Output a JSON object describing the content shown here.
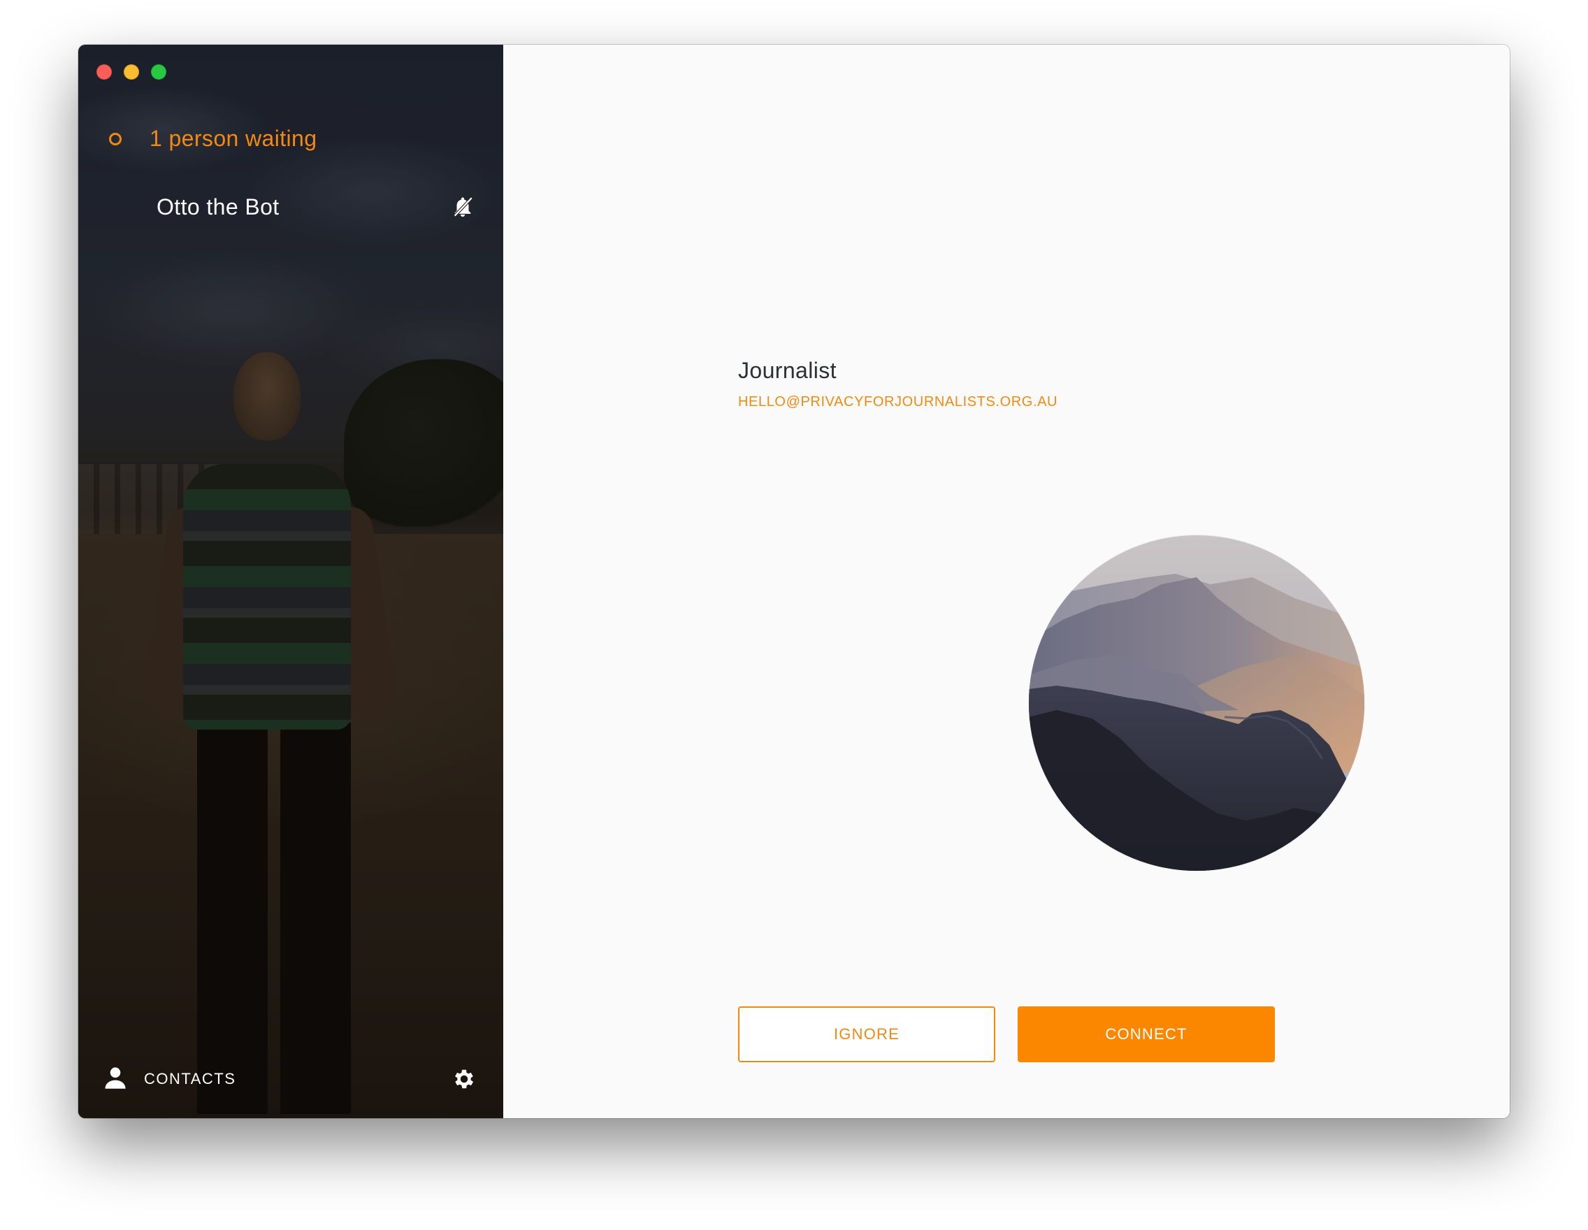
{
  "window": {
    "controls": [
      "close",
      "minimize",
      "maximize"
    ]
  },
  "sidebar": {
    "status_text": "1 person waiting",
    "contact": {
      "name": "Otto the Bot",
      "notification_icon": "bell-off-icon"
    },
    "footer": {
      "contacts_label": "CONTACTS",
      "contacts_icon": "person-icon",
      "settings_icon": "gear-icon"
    }
  },
  "profile": {
    "name": "Journalist",
    "email": "HELLO@PRIVACYFORJOURNALISTS.ORG.AU"
  },
  "actions": {
    "ignore_label": "IGNORE",
    "connect_label": "CONNECT"
  },
  "colors": {
    "accent": "#f28a12",
    "connect_bg": "#fb8600",
    "main_bg": "#fafafa",
    "text_dark": "#2c2f33"
  }
}
